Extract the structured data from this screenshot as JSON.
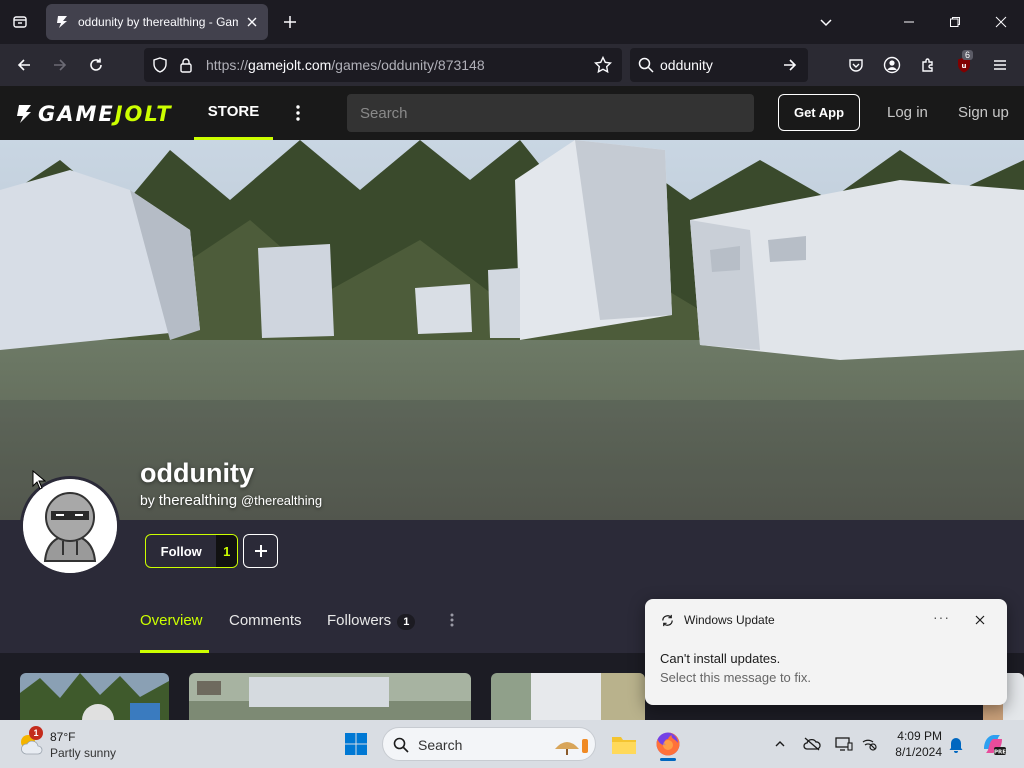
{
  "browser": {
    "tab_title": "oddunity by therealthing - Game Jolt",
    "url_prefix": "https://",
    "url_host": "gamejolt.com",
    "url_path": "/games/oddunity/873148",
    "search_query": "oddunity",
    "extension_badge": "6"
  },
  "site": {
    "logo_part1": "GAME",
    "logo_part2": "JOLT",
    "store_label": "STORE",
    "search_placeholder": "Search",
    "get_app_label": "Get App",
    "login_label": "Log in",
    "signup_label": "Sign up"
  },
  "game": {
    "title": "oddunity",
    "by_prefix": "by",
    "developer": "therealthing",
    "handle": "@therealthing",
    "follow_label": "Follow",
    "follow_count": "1"
  },
  "subtabs": {
    "overview": "Overview",
    "comments": "Comments",
    "followers": "Followers",
    "followers_count": "1"
  },
  "toast": {
    "app_name": "Windows Update",
    "more": "···",
    "line1": "Can't install updates.",
    "line2": "Select this message to fix."
  },
  "taskbar": {
    "weather_temp": "87°F",
    "weather_desc": "Partly sunny",
    "weather_badge": "1",
    "search_label": "Search",
    "time": "4:09 PM",
    "date": "8/1/2024"
  },
  "colors": {
    "accent": "#ccff00",
    "header_bg": "#191919",
    "profile_bg": "#2b2a38"
  }
}
